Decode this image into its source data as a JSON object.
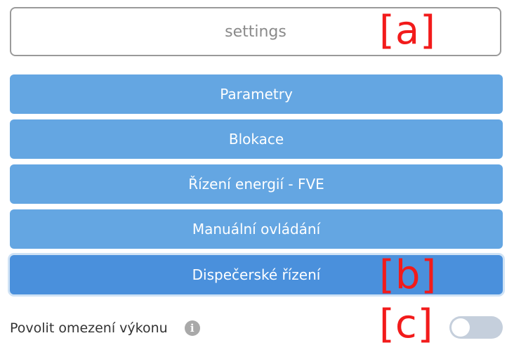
{
  "settings": {
    "label": "settings"
  },
  "menu": {
    "items": [
      {
        "label": "Parametry"
      },
      {
        "label": "Blokace"
      },
      {
        "label": "Řízení energií - FVE"
      },
      {
        "label": "Manuální ovládání"
      },
      {
        "label": "Dispečerské řízení"
      }
    ],
    "active_index": 4
  },
  "markers": {
    "a": "[a]",
    "b": "[b]",
    "c": "[c]"
  },
  "power_limit": {
    "label": "Povolit omezení výkonu",
    "info_icon": "info-icon",
    "info_glyph": "i",
    "enabled": false
  },
  "colors": {
    "button": "#64a6e2",
    "button_active": "#4a90dc",
    "marker": "#f21b1b",
    "toggle_off": "#c5cfdc"
  }
}
